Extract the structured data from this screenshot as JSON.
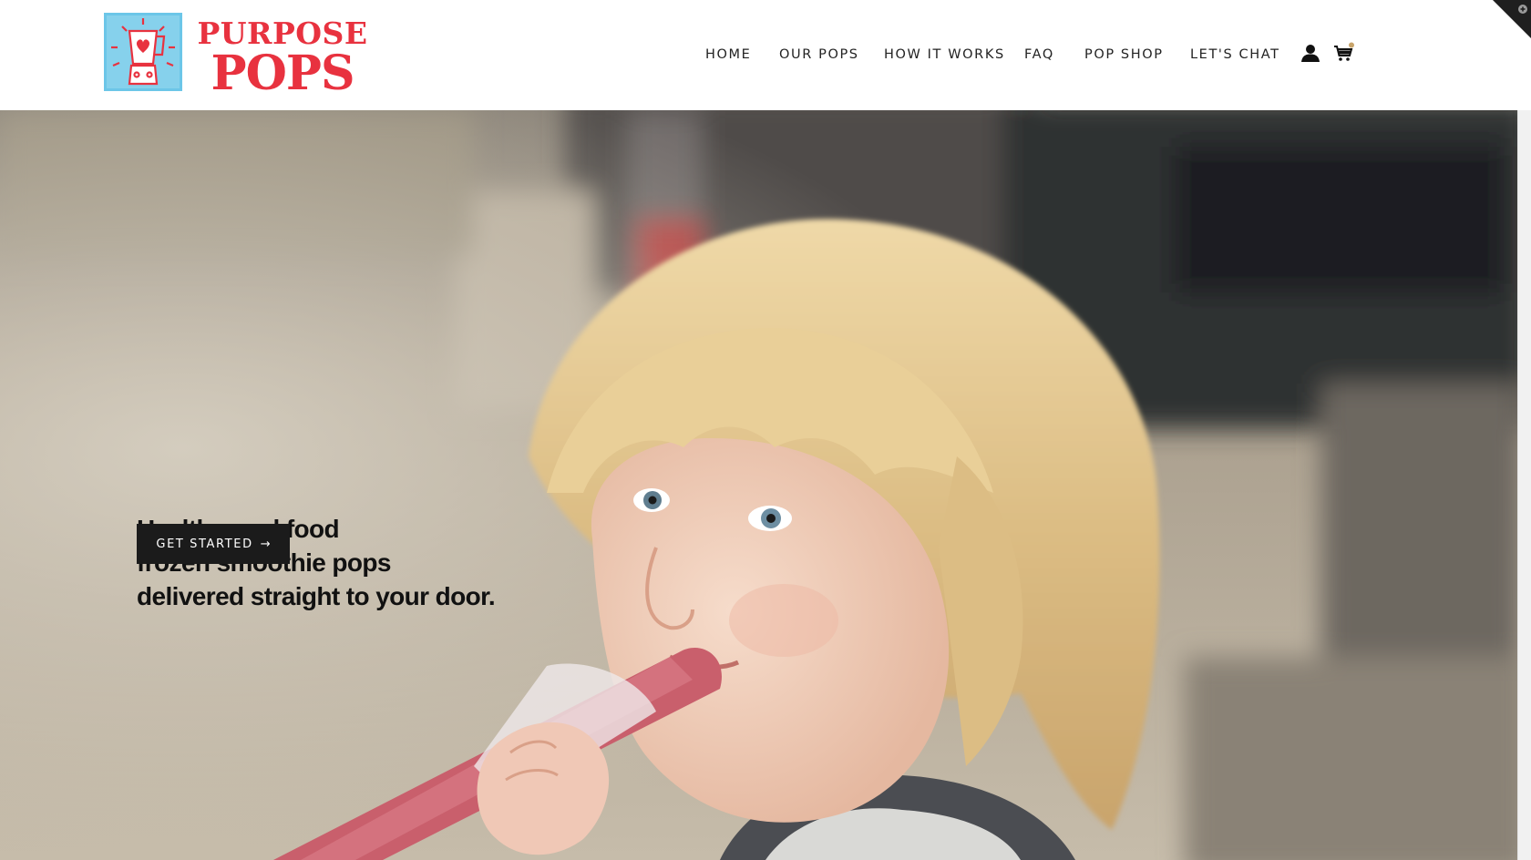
{
  "brand": {
    "logo_line1": "PURPOSE",
    "logo_line2": "POPS",
    "accent_red": "#e8323f",
    "logo_bg": "#6cc6e8"
  },
  "nav": {
    "items": [
      {
        "label": "HOME"
      },
      {
        "label": "OUR POPS"
      },
      {
        "label": "HOW IT WORKS"
      },
      {
        "label": "FAQ"
      },
      {
        "label": "POP SHOP"
      },
      {
        "label": "LET'S CHAT"
      }
    ],
    "account_icon": "user-icon",
    "cart_icon": "cart-icon",
    "cart_dot_color": "#c8a46a"
  },
  "hero": {
    "headline_lines": [
      "Healthy, real food",
      "frozen smoothie pops",
      "delivered straight to your door."
    ],
    "cta_label": "GET STARTED",
    "cta_arrow": "→",
    "image_subject": "child eating a pink smoothie pop"
  }
}
